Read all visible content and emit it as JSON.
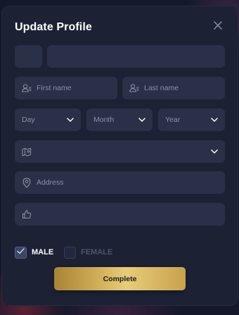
{
  "modal": {
    "title": "Update Profile"
  },
  "form": {
    "country_code_value": "",
    "phone_value": "",
    "first_name_placeholder": "First name",
    "last_name_placeholder": "Last name",
    "birth_day_label": "Day",
    "birth_month_label": "Month",
    "birth_year_label": "Year",
    "region_value": "",
    "address_placeholder": "Address",
    "referral_value": "",
    "gender_male_label": "MALE",
    "gender_female_label": "FEMALE",
    "gender_selected": "MALE",
    "submit_label": "Complete"
  },
  "icons": {
    "close": "close-icon",
    "first_name": "user-list-icon",
    "last_name": "user-list-icon",
    "region": "map-pin-icon",
    "address": "location-pin-icon",
    "referral": "thumbs-up-icon",
    "dropdown": "chevron-down-icon",
    "checked": "checkmark-icon"
  },
  "colors": {
    "modal_bg": "#1c2134",
    "field_bg": "#2a3048",
    "accent_gold": "#d3b05a",
    "text_primary": "#ffffff",
    "text_muted": "#8990aa"
  }
}
